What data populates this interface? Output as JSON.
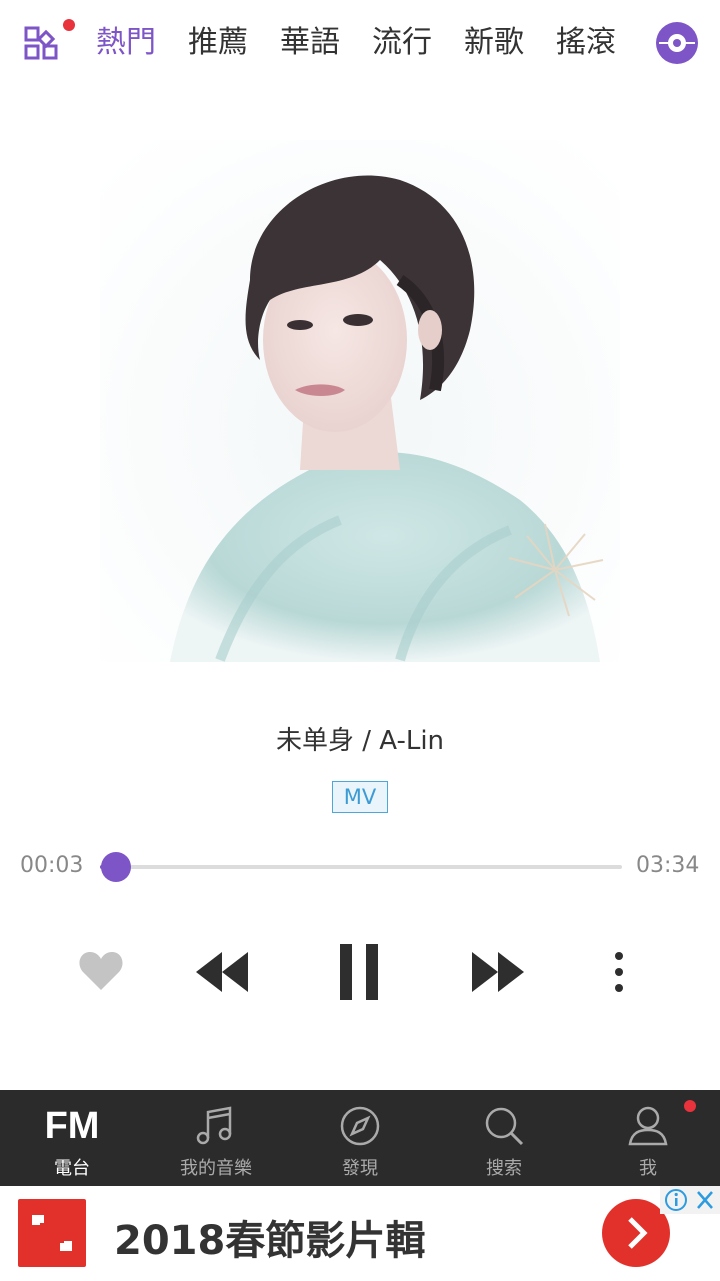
{
  "top_tabs": {
    "items": [
      "熱門",
      "推薦",
      "華語",
      "流行",
      "新歌",
      "搖滾"
    ],
    "active_index": 0
  },
  "song": {
    "title": "未单身 / A-Lin",
    "mv_label": "MV"
  },
  "progress": {
    "current": "00:03",
    "total": "03:34",
    "fraction": 0.015
  },
  "bottom_nav": {
    "fm_text": "FM",
    "items": [
      "電台",
      "我的音樂",
      "發現",
      "搜索",
      "我"
    ]
  },
  "ad": {
    "text": "2018春節影片輯"
  },
  "colors": {
    "accent": "#7d55c7",
    "badge_red": "#e8323c",
    "nav_bg": "#2b2b2b",
    "mv_blue": "#3d9bd4"
  },
  "icons": {
    "grid": "grid-icon",
    "disc": "disc-icon",
    "heart": "heart-icon",
    "prev": "rewind-icon",
    "pause": "pause-icon",
    "next": "fast-forward-icon",
    "more": "more-vertical-icon",
    "music": "music-note-icon",
    "discover": "compass-icon",
    "search": "search-icon",
    "me": "person-icon"
  }
}
